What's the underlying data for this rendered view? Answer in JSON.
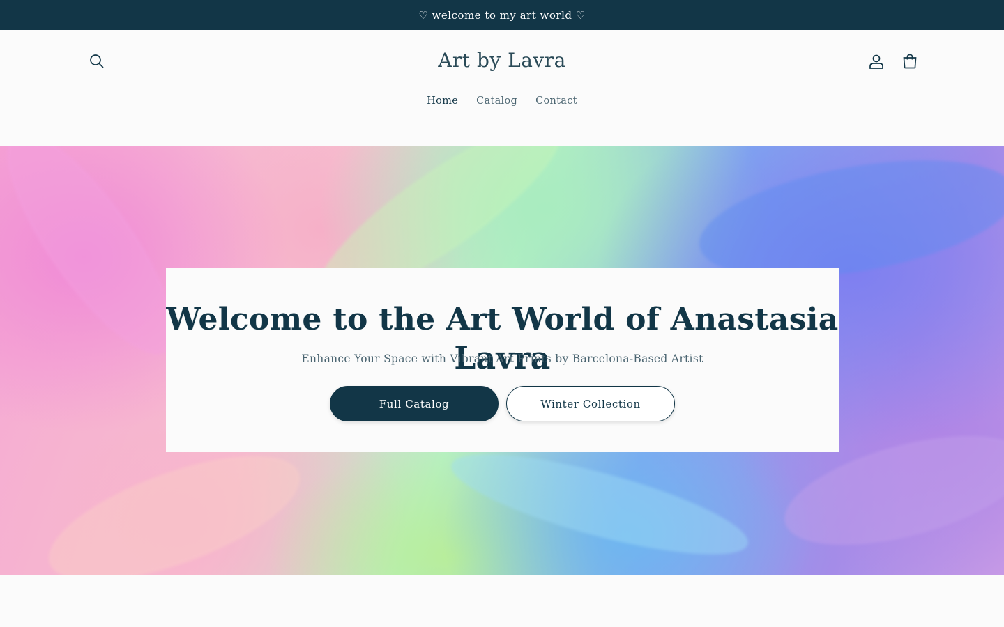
{
  "announcement": {
    "text": "♡ welcome to my art world ♡"
  },
  "header": {
    "brand": "Art by Lavra",
    "search_icon": "search-icon",
    "account_icon": "user-icon",
    "cart_icon": "shopping-bag-icon"
  },
  "nav": {
    "items": [
      {
        "label": "Home",
        "active": true
      },
      {
        "label": "Catalog",
        "active": false
      },
      {
        "label": "Contact",
        "active": false
      }
    ]
  },
  "hero": {
    "title": "Welcome to the Art World of Anastasia Lavra",
    "subtitle": "Enhance Your Space with Vibrant Art Prints by Barcelona-Based Artist",
    "primary_button": "Full Catalog",
    "secondary_button": "Winter Collection"
  },
  "colors": {
    "primary": "#123647",
    "background": "#fbfbfb",
    "text_muted": "#4a6470"
  }
}
